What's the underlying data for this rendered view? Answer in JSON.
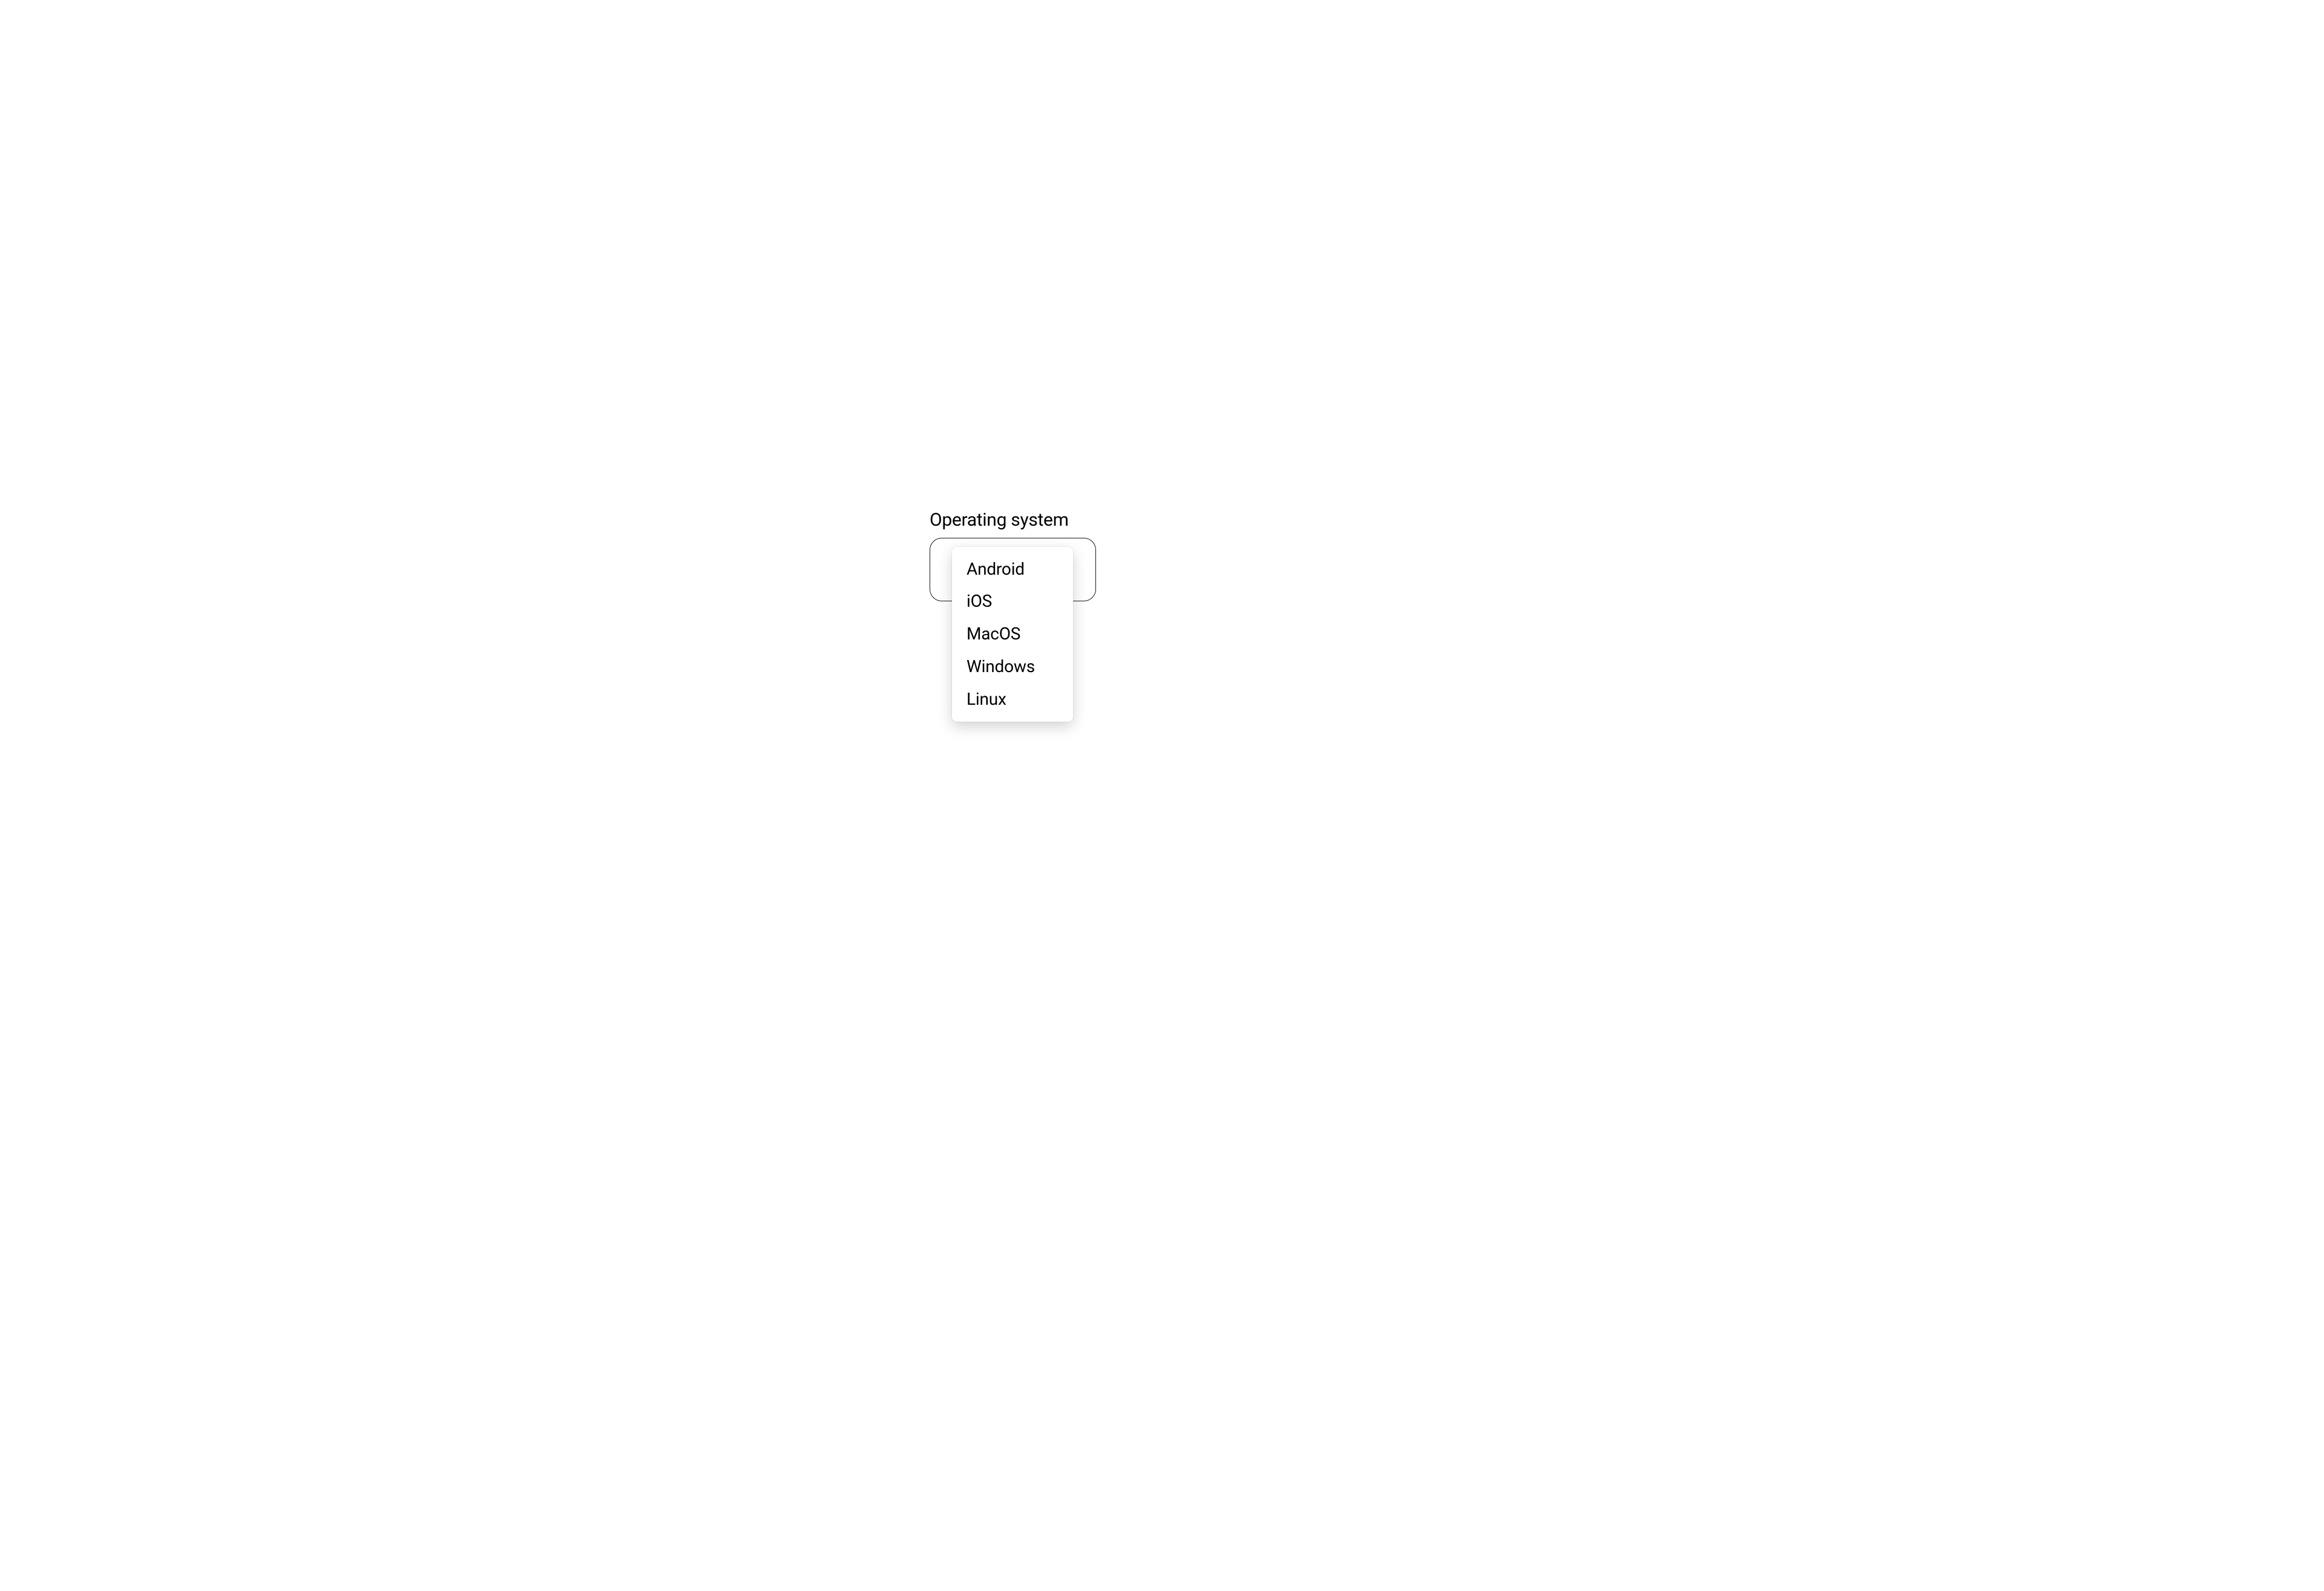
{
  "select": {
    "label": "Operating system",
    "options": [
      "Android",
      "iOS",
      "MacOS",
      "Windows",
      "Linux"
    ]
  }
}
